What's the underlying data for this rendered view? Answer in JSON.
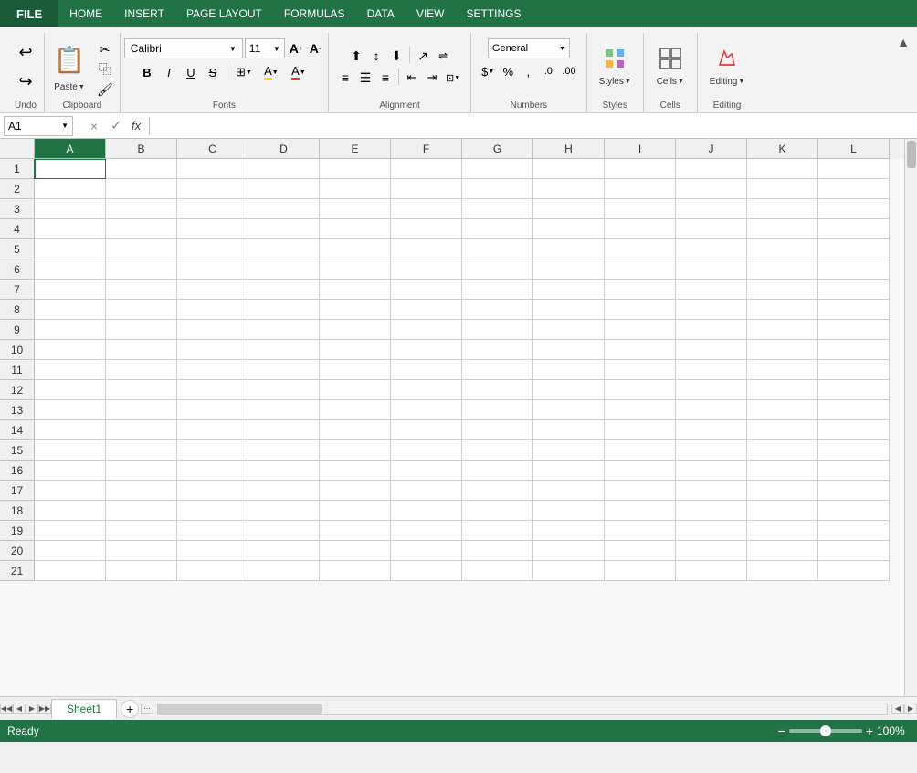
{
  "menu": {
    "file": "FILE",
    "items": [
      "HOME",
      "INSERT",
      "PAGE LAYOUT",
      "FORMULAS",
      "DATA",
      "VIEW",
      "SETTINGS"
    ]
  },
  "ribbon": {
    "collapse_label": "▲",
    "groups": {
      "undo": {
        "label": "Undo",
        "undo_label": "Undo",
        "redo_label": "Redo"
      },
      "clipboard": {
        "label": "Clipboard",
        "paste_label": "Paste",
        "cut_label": "Cut",
        "copy_label": "Copy",
        "format_label": "Format"
      },
      "fonts": {
        "label": "Fonts",
        "font_name": "Calibri",
        "font_size": "11",
        "bold_label": "B",
        "italic_label": "I",
        "underline_label": "U",
        "strikethrough_label": "S",
        "border_label": "⊞",
        "fill_label": "A",
        "color_label": "A"
      },
      "alignment": {
        "label": "Alignment"
      },
      "numbers": {
        "label": "Numbers"
      },
      "styles": {
        "label": "Styles"
      },
      "cells": {
        "label": "Cells"
      },
      "editing": {
        "label": "Editing"
      }
    }
  },
  "formula_bar": {
    "cell_ref": "A1",
    "formula_x": "×",
    "formula_check": "✓",
    "fx": "fx",
    "value": ""
  },
  "spreadsheet": {
    "columns": [
      "A",
      "B",
      "C",
      "D",
      "E",
      "F",
      "G",
      "H",
      "I",
      "J",
      "K",
      "L"
    ],
    "rows": [
      1,
      2,
      3,
      4,
      5,
      6,
      7,
      8,
      9,
      10,
      11,
      12,
      13,
      14,
      15,
      16,
      17,
      18,
      19,
      20,
      21
    ],
    "active_cell": "A1"
  },
  "sheet_tabs": {
    "tabs": [
      {
        "label": "Sheet1",
        "active": true
      }
    ],
    "add_label": "+"
  },
  "status_bar": {
    "status": "Ready",
    "zoom_minus": "−",
    "zoom_plus": "+",
    "zoom_pct": "100%"
  }
}
